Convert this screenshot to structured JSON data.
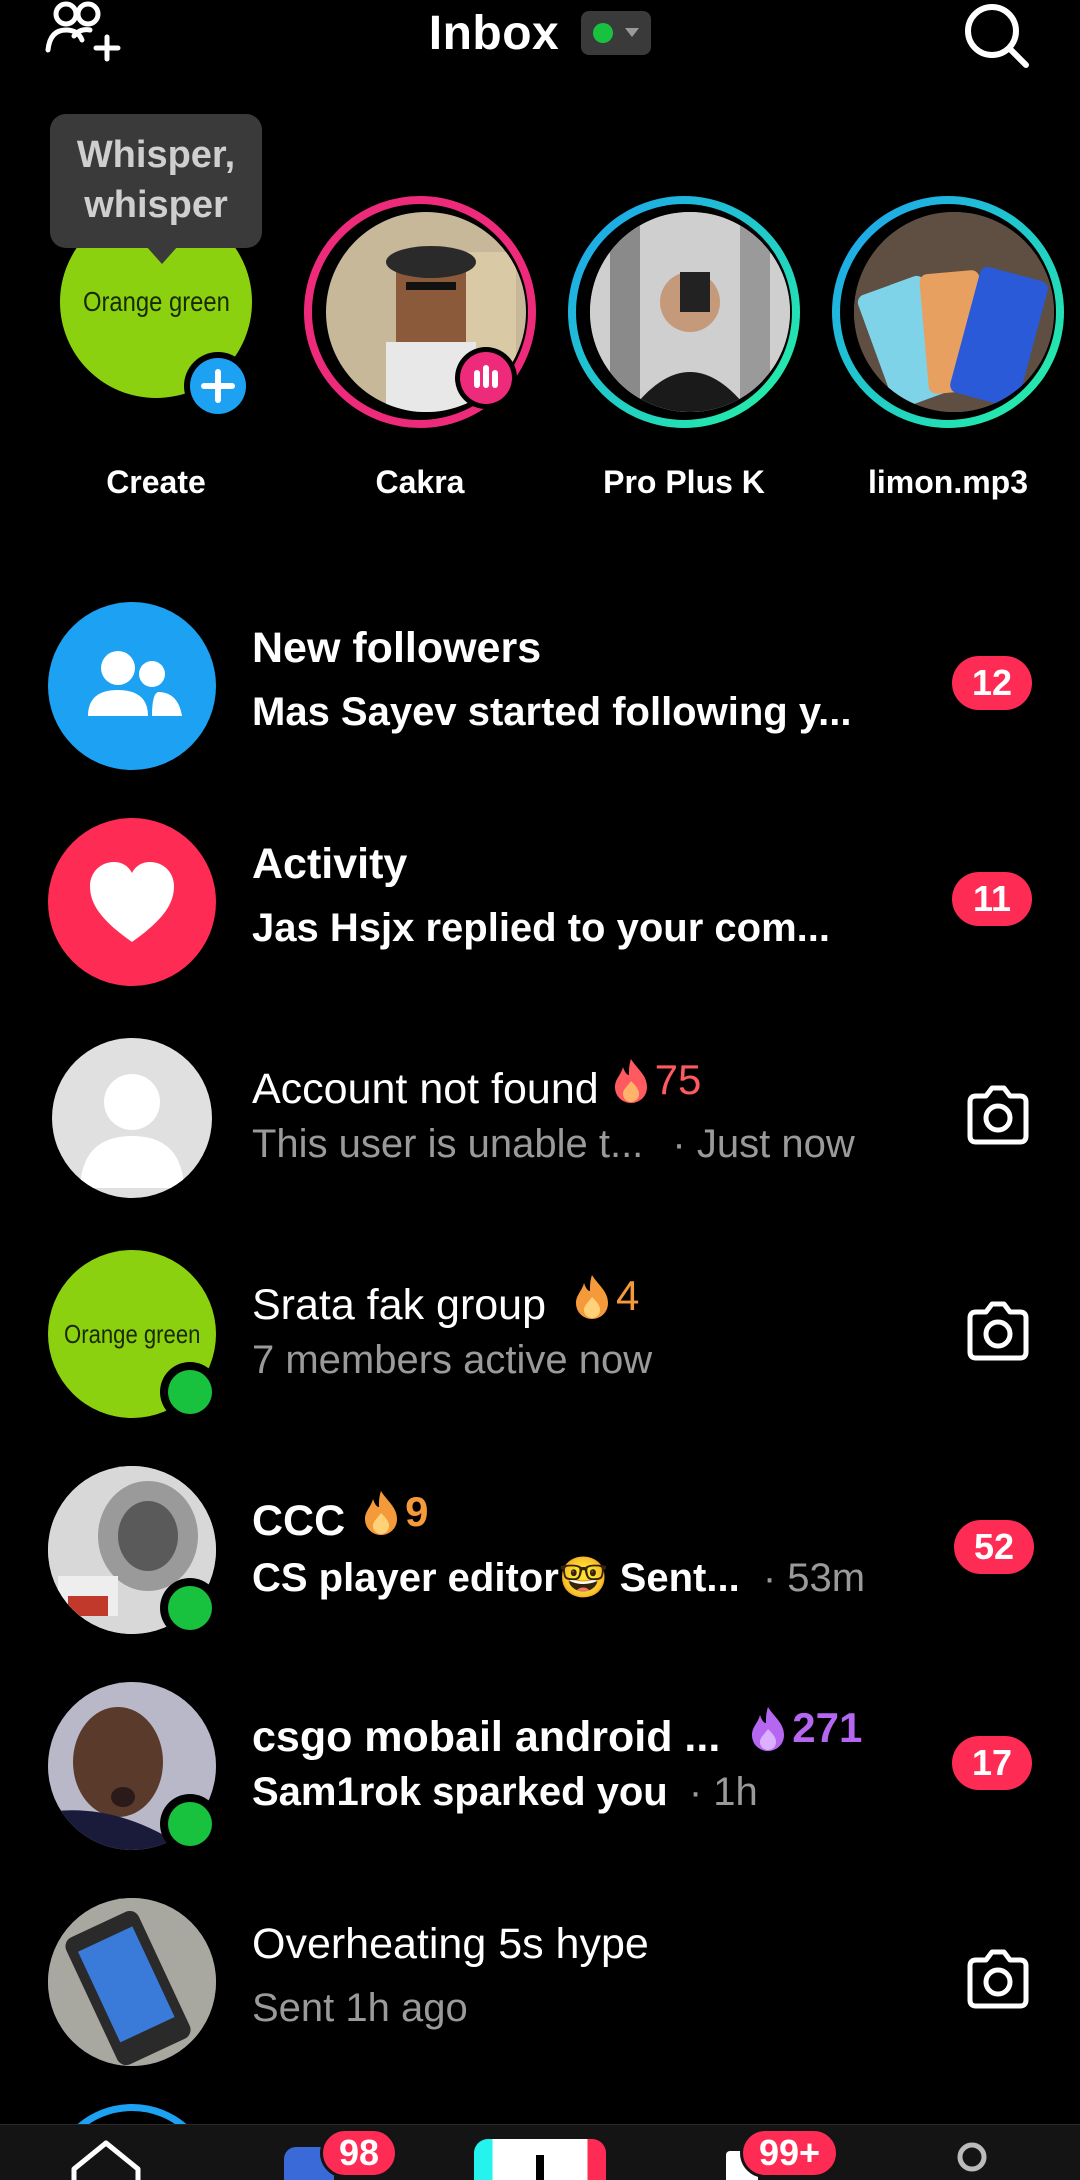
{
  "header": {
    "title": "Inbox",
    "status_color": "#19c23e"
  },
  "tooltip": "Whisper, whisper",
  "stories": [
    {
      "name": "Create",
      "avatar_text": "Orange green"
    },
    {
      "name": "Cakra"
    },
    {
      "name": "Pro Plus K"
    },
    {
      "name": "limon.mp3"
    }
  ],
  "rows": [
    {
      "title": "New followers",
      "subtitle": "Mas Sayev started following y...",
      "badge": "12",
      "icon": "people-icon"
    },
    {
      "title": "Activity",
      "subtitle": "Jas Hsjx replied to your com...",
      "badge": "11",
      "icon": "heart-icon"
    },
    {
      "title": "Account not found",
      "streak": "75",
      "subtitle": "This user is unable t...",
      "time": "· Just now",
      "icon": "camera-icon"
    },
    {
      "title": "Srata fak group",
      "streak": "4",
      "subtitle": "7 members active now",
      "avatar_text": "Orange green",
      "icon": "camera-icon"
    },
    {
      "title": "CCC",
      "streak": "9",
      "subtitle": "CS player editor🤓 Sent...",
      "time": "· 53m",
      "badge": "52"
    },
    {
      "title": "csgo mobail android ...",
      "streak": "271",
      "subtitle": "Sam1rok sparked you",
      "time": "· 1h",
      "badge": "17"
    },
    {
      "title": "Overheating 5s hype",
      "subtitle": "Sent 1h ago",
      "icon": "camera-icon"
    }
  ],
  "tabbar": {
    "friends_badge": "98",
    "inbox_badge": "99+"
  },
  "colors": {
    "accent_red": "#fe2c55",
    "blue": "#1da1f2",
    "online_green": "#19c23e",
    "streak_orange": "#f59a3b",
    "streak_red": "#ff5a5f",
    "streak_purple": "#b667f1"
  }
}
